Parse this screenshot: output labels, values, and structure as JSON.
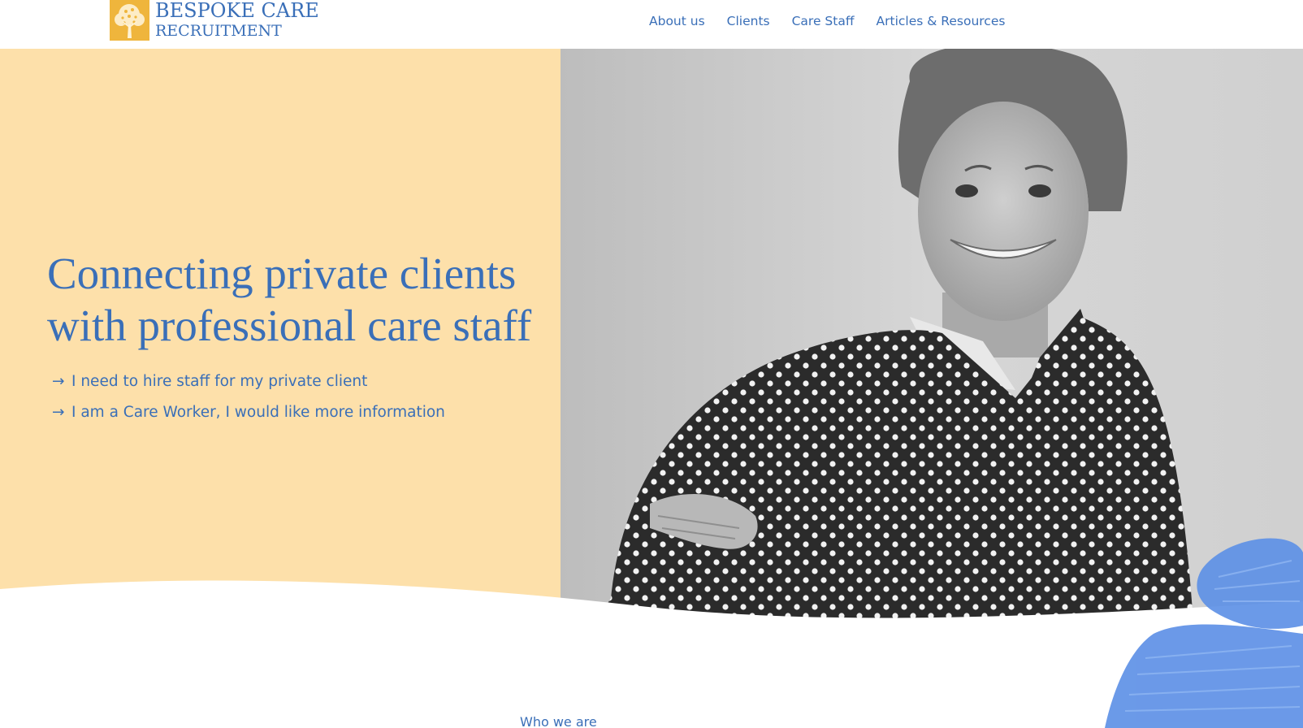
{
  "logo": {
    "line1": "BESPOKE CARE",
    "line2": "RECRUITMENT",
    "mark_icon": "tree-icon",
    "mark_color": "#efb53c"
  },
  "nav": {
    "items": [
      {
        "label": "About us"
      },
      {
        "label": "Clients"
      },
      {
        "label": "Care Staff"
      },
      {
        "label": "Articles & Resources"
      }
    ]
  },
  "hero": {
    "headline": "Connecting private clients with professional care staff",
    "links": [
      {
        "arrow": "→",
        "label": "I need to hire staff for my private client"
      },
      {
        "arrow": "→",
        "label": "I am a Care Worker, I would like more information"
      }
    ],
    "photo_icon": "portrait-photo",
    "background_color": "#fde0aa"
  },
  "section": {
    "eyebrow": "Who we are"
  },
  "colors": {
    "brand_blue": "#3a6fb8",
    "accent_orange": "#efb53c",
    "brush_blue": "#5b8fe6"
  }
}
